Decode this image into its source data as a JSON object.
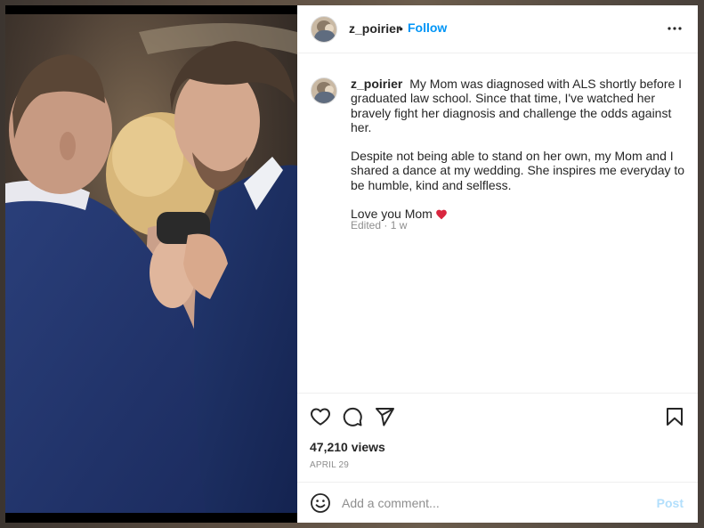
{
  "header": {
    "username": "z_poirier",
    "separator": "•",
    "follow_label": "Follow",
    "more_icon": "more-horizontal-icon"
  },
  "caption": {
    "username": "z_poirier",
    "paragraphs": [
      "My Mom was diagnosed with ALS shortly before I graduated law school. Since that time, I've watched her bravely fight her diagnosis and challenge the odds against her.",
      "Despite not being able to stand on her own, my Mom and I shared a dance at my wedding. She inspires me everyday to be humble, kind and selfless.",
      "Love you Mom"
    ],
    "emoji": "red-heart-icon",
    "meta": "Edited · 1 w"
  },
  "actions": {
    "like_icon": "heart-icon",
    "comment_icon": "comment-icon",
    "share_icon": "send-icon",
    "save_icon": "bookmark-icon",
    "views": "47,210 views",
    "date": "APRIL 29"
  },
  "comment": {
    "emoji_icon": "smiley-icon",
    "placeholder": "Add a comment...",
    "post_label": "Post"
  },
  "colors": {
    "accent": "#0095f6",
    "post_disabled": "#b2dffc",
    "text": "#262626",
    "muted": "#8e8e8e",
    "heart": "#e0245e"
  }
}
